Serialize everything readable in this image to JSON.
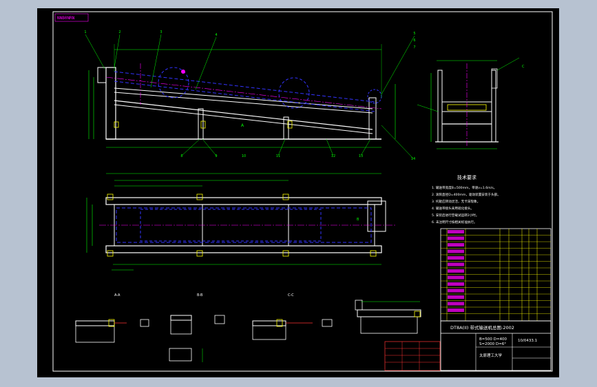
{
  "canvas": {
    "background": "#000000",
    "outer_background": "#b7c2d1",
    "border_color": "#ffffff",
    "colors": {
      "frame": "#ffffff",
      "dim": "#00ff00",
      "hidden": "#2222ff",
      "center": "#ff00ff",
      "note": "#ffff00",
      "red": "#ff3333"
    }
  },
  "corner_stamp": "NNB0NRN",
  "title_block": {
    "title": "DT8A(II) 带式输送机总图-2002",
    "spec_line1": "B=500  D=400",
    "spec_line2": "S=2000  D=6°",
    "drawing_no": "10/0433.1",
    "unit": "太原理工大学"
  },
  "sections": {
    "elevation": "A",
    "plan": "B",
    "end_view": "C",
    "section_1": "A-A",
    "section_2": "B-B",
    "section_3": "C-C"
  },
  "tech_requirements": {
    "heading": "技术要求",
    "lines": [
      "1. 输送带宽度B=500mm，带速v=1.6m/s。",
      "2. 滚筒直径D=400mm，驱动装置安装于头部。",
      "3. 托辊应转动灵活，无卡滞现象。",
      "4. 输送带接头采用硫化接头。",
      "5. 安装后进行空载试运转2小时。",
      "6. 未注明尺寸按相关标准执行。"
    ]
  },
  "part_labels": [
    "1",
    "2",
    "3",
    "4",
    "5",
    "6",
    "7",
    "8",
    "9",
    "10",
    "11",
    "12",
    "13",
    "14"
  ]
}
